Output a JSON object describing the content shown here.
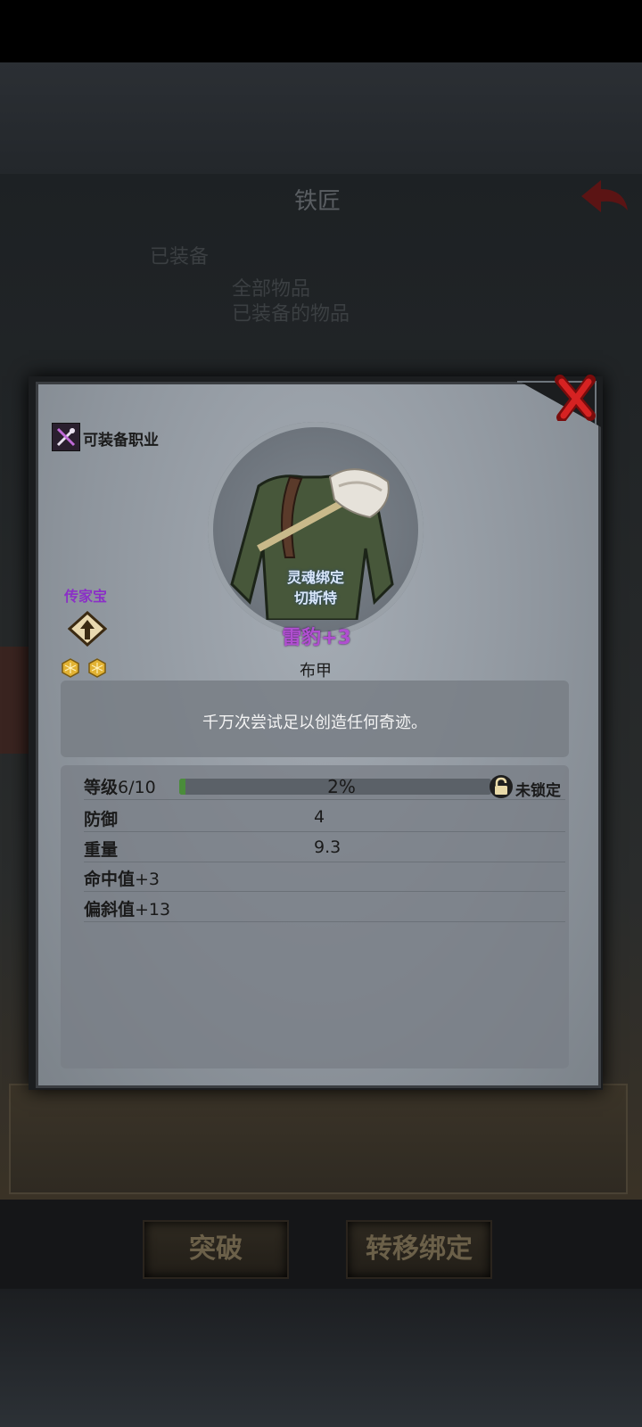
{
  "background": {
    "title": "铁匠",
    "blurred_lines": [
      "已装备",
      "全部物品",
      "已装备的物品"
    ]
  },
  "modal": {
    "class_label": "可装备职业",
    "rarity_label": "传家宝",
    "soulbound_line1": "灵魂绑定",
    "soulbound_line2": "切斯特",
    "item_name": "雷豹+3",
    "item_type": "布甲",
    "description": "千万次尝试足以创造任何奇迹。",
    "level": {
      "label": "等级",
      "value": "6/10",
      "progress_text": "2%",
      "progress_fraction": 0.02,
      "lock_label": "未锁定"
    },
    "stats": [
      {
        "label": "防御",
        "value": "4"
      },
      {
        "label": "重量",
        "value": "9.3"
      },
      {
        "label": "命中值",
        "value": "+3"
      },
      {
        "label": "偏斜值",
        "value": "+13"
      }
    ],
    "gems": 2
  },
  "actions": {
    "breakthrough": "突破",
    "transfer_binding": "转移绑定"
  },
  "colors": {
    "item_name": "#b04fd0",
    "rarity": "#8b2fc7",
    "soulbound": "#d8e6f8",
    "close": "#c41e1e"
  }
}
